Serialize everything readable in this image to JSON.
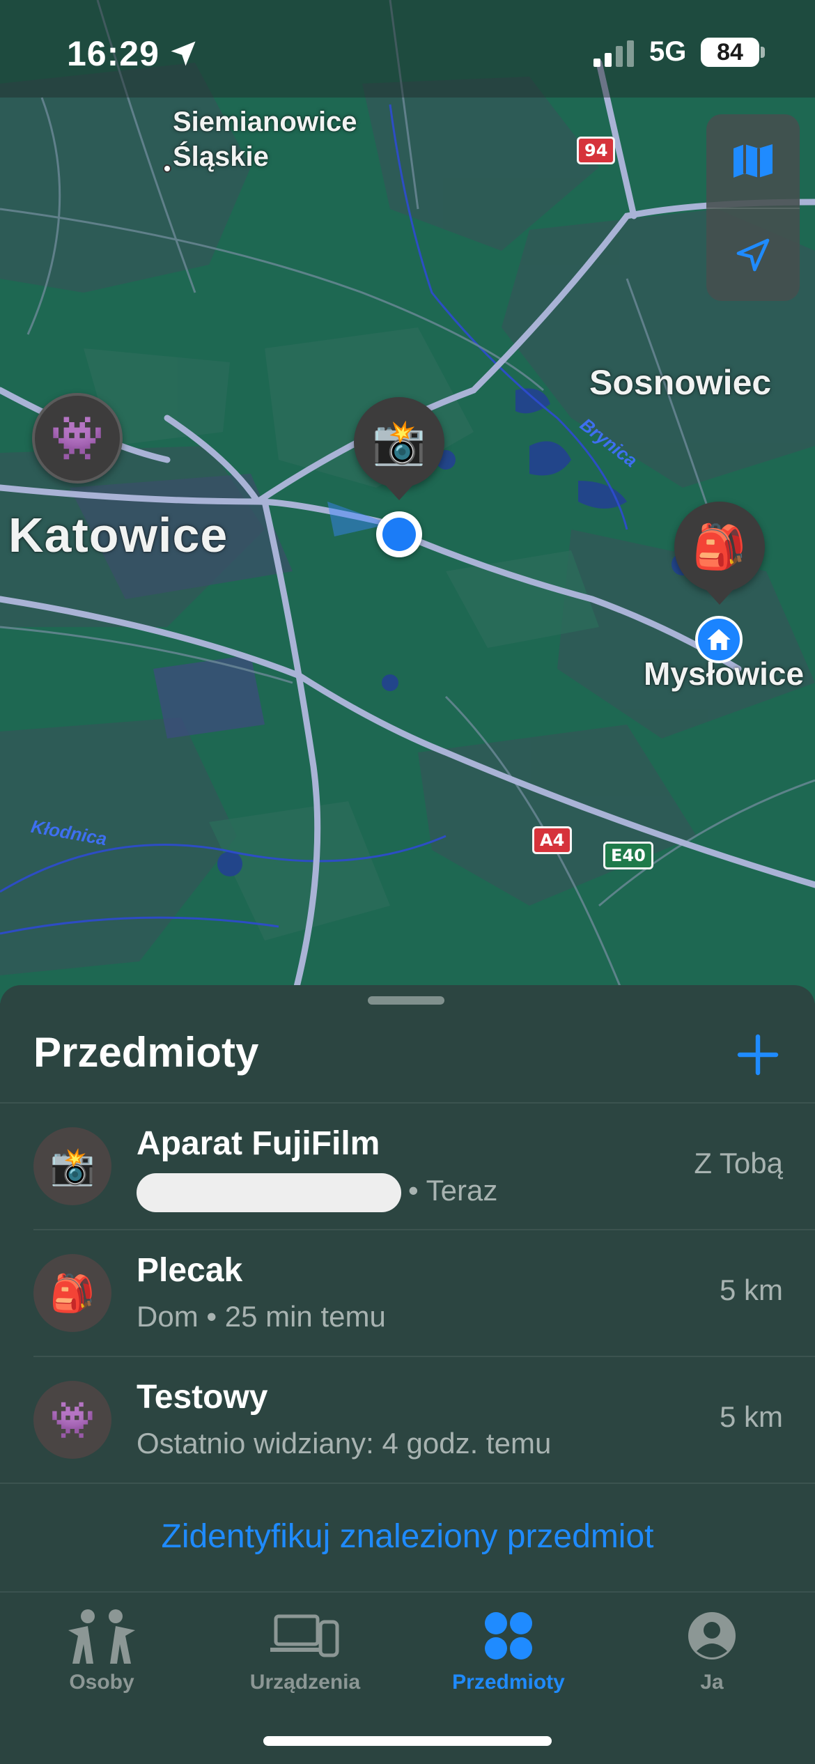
{
  "status_bar": {
    "time": "16:29",
    "network": "5G",
    "battery": "84"
  },
  "map": {
    "labels": {
      "siemianowice_line1": "Siemianowice",
      "siemianowice_line2": "Śląskie",
      "sosnowiec": "Sosnowiec",
      "katowice": "Katowice",
      "myslowice": "Mysłowice",
      "brynica": "Brynica",
      "klodnica": "Kłodnica"
    },
    "road_shields": {
      "r94": "94",
      "a4": "A4",
      "e40": "E40"
    },
    "pins": {
      "camera": "📸",
      "backpack": "🎒",
      "alien": "👾"
    },
    "controls": [
      "map-icon",
      "location-arrow-icon"
    ]
  },
  "sheet": {
    "title": "Przedmioty",
    "items": [
      {
        "emoji": "📸",
        "name": "Aparat FujiFilm",
        "subtitle": "• Teraz",
        "distance": "Z Tobą"
      },
      {
        "emoji": "🎒",
        "name": "Plecak",
        "subtitle": "Dom • 25 min temu",
        "distance": "5 km"
      },
      {
        "emoji": "👾",
        "name": "Testowy",
        "subtitle": "Ostatnio widziany: 4 godz. temu",
        "distance": "5 km"
      }
    ],
    "identify_link": "Zidentyfikuj znaleziony przedmiot"
  },
  "tabbar": {
    "tabs": [
      {
        "label": "Osoby",
        "icon": "people-icon",
        "active": false
      },
      {
        "label": "Urządzenia",
        "icon": "devices-icon",
        "active": false
      },
      {
        "label": "Przedmioty",
        "icon": "items-icon",
        "active": true
      },
      {
        "label": "Ja",
        "icon": "person-circle-icon",
        "active": false
      }
    ]
  },
  "colors": {
    "accent": "#1f8bff",
    "sheet_bg": "#2c4541",
    "map_green": "#1f6a55"
  }
}
